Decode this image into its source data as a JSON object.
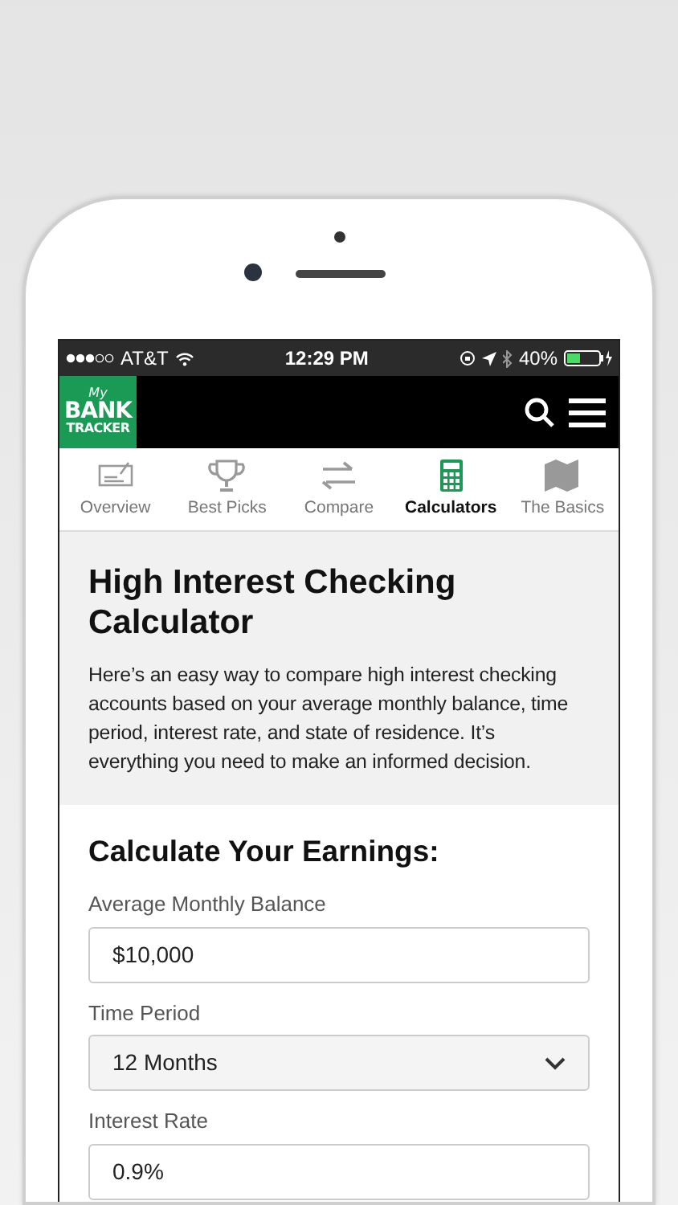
{
  "status_bar": {
    "carrier": "AT&T",
    "time": "12:29 PM",
    "battery": "40%"
  },
  "logo": {
    "line1": "My",
    "line2": "BANK",
    "line3": "TRACKER"
  },
  "tabs": [
    {
      "label": "Overview",
      "selected": false
    },
    {
      "label": "Best Picks",
      "selected": false
    },
    {
      "label": "Compare",
      "selected": false
    },
    {
      "label": "Calculators",
      "selected": true
    },
    {
      "label": "The Basics",
      "selected": false
    }
  ],
  "intro": {
    "title": "High Interest Checking Calculator",
    "text": "Here’s an easy way to compare high interest checking accounts based on your average monthly balance, time period, interest rate, and state of residence. It’s everything you need to make an informed decision."
  },
  "form": {
    "heading": "Calculate Your Earnings:",
    "fields": [
      {
        "label": "Average Monthly Balance",
        "value": "$10,000",
        "kind": "text"
      },
      {
        "label": "Time Period",
        "value": "12 Months",
        "kind": "select"
      },
      {
        "label": "Interest Rate",
        "value": "0.9%",
        "kind": "text"
      }
    ]
  }
}
